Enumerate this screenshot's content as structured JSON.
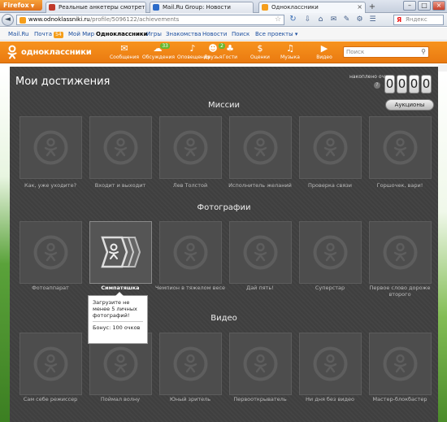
{
  "browser": {
    "menu_button": "Firefox",
    "tabs": [
      {
        "label": "Реальные анкетеры смотреть онлайн",
        "favicon_color": "#c0392b"
      },
      {
        "label": "Mail.Ru Group: Новости",
        "favicon_color": "#2c6bc9"
      },
      {
        "label": "Одноклассники",
        "favicon_color": "#f59e1b"
      }
    ],
    "new_tab_symbol": "+",
    "window_buttons": [
      "–",
      "□",
      "×"
    ],
    "url": {
      "domain": "www.odnoklassniki.ru",
      "path": "/profile/5096122/achievements"
    },
    "search_engine": "Я",
    "search_placeholder": "Яндекс",
    "back_symbol": "◄",
    "reload_symbol": "↻",
    "star_symbol": "☆",
    "tool_icons": [
      "⇩",
      "⌂",
      "✉",
      "✎",
      "⚙",
      "☰"
    ]
  },
  "mailbar": {
    "items": [
      {
        "label": "Mail.Ru",
        "badge": ""
      },
      {
        "label": "Почта",
        "badge": "54"
      },
      {
        "label": "Мой Мир",
        "badge": ""
      },
      {
        "label": "Одноклассники",
        "badge": "",
        "bold": true
      },
      {
        "label": "Игры",
        "badge": ""
      },
      {
        "label": "Знакомства",
        "badge": ""
      },
      {
        "label": "Новости",
        "badge": ""
      },
      {
        "label": "Поиск",
        "badge": ""
      },
      {
        "label": "Все проекты ▾",
        "badge": ""
      }
    ]
  },
  "okheader": {
    "logo_text": "одноклассники",
    "nav": [
      {
        "label": "Сообщения",
        "icon": "✉",
        "count": ""
      },
      {
        "label": "Обсуждения",
        "icon": "☁",
        "count": "33"
      },
      {
        "label": "Оповещения",
        "icon": "♪",
        "count": ""
      },
      {
        "label": "Друзья",
        "icon": "☻",
        "count": "2"
      },
      {
        "label": "Гости",
        "icon": "♣",
        "count": ""
      },
      {
        "label": "Оценки",
        "icon": "$",
        "count": ""
      },
      {
        "label": "Музыка",
        "icon": "♫",
        "count": ""
      },
      {
        "label": "Видео",
        "icon": "▶",
        "count": ""
      }
    ],
    "search_placeholder": "Поиск",
    "search_icon": "⚲"
  },
  "achievements": {
    "title": "Мои достижения",
    "score_label": "накоплено очков",
    "score_digits": [
      "0",
      "0",
      "0",
      "0"
    ],
    "help_symbol": "?",
    "auction_button": "Аукционы",
    "sections": [
      {
        "title": "Миссии",
        "items": [
          "Как, уже уходите?",
          "Входит и выходит",
          "Лев Толстой",
          "Исполнитель желаний",
          "Проверка связи",
          "Горшочек, вари!"
        ]
      },
      {
        "title": "Фотографии",
        "items": [
          "Фотоаппарат",
          "Симпатяшка",
          "Чемпион в тяжелом весе",
          "Дай пять!",
          "Суперстар",
          "Первое слово дороже второго"
        ]
      },
      {
        "title": "Видео",
        "items": [
          "Сам себе режиссер",
          "Поймал волну",
          "Юный зритель",
          "Первооткрыватель",
          "Ни дня без видео",
          "Мастер-блокбастер"
        ]
      }
    ],
    "tooltip": {
      "text": "Загрузите не менее 5 личных фотографий!",
      "bonus": "Бонус: 100 очков"
    }
  },
  "colors": {
    "orange": "#f7931e",
    "panel": "#3f3f3f",
    "green_badge": "#68b82e"
  }
}
